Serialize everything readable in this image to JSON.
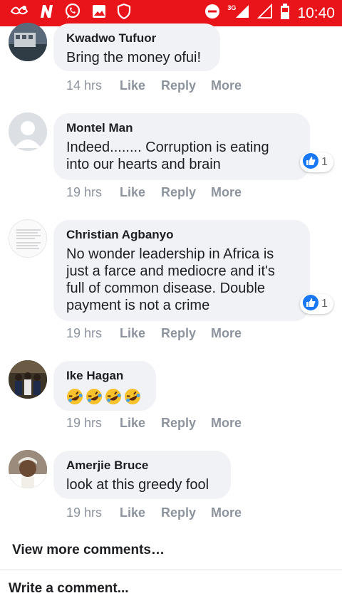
{
  "status_bar": {
    "time": "10:40",
    "network": "3G",
    "icons": [
      "notification-app-icon",
      "n-app-icon",
      "whatsapp-icon",
      "image-icon",
      "shield-icon",
      "do-not-disturb-icon",
      "signal-icon",
      "signal-empty-icon",
      "battery-icon"
    ],
    "bg_color": "#e8141a"
  },
  "comments": [
    {
      "author": "Kwadwo Tufuor",
      "text": "Bring the money ofui!",
      "time": "14 hrs",
      "like": "Like",
      "reply": "Reply",
      "more": "More",
      "reactions": null
    },
    {
      "author": "Montel Man",
      "text": "Indeed........ Corruption is eating\ninto our hearts and brain",
      "time": "19 hrs",
      "like": "Like",
      "reply": "Reply",
      "more": "More",
      "reactions": "1"
    },
    {
      "author": "Christian Agbanyo",
      "text": "No wonder leadership in Africa is\njust a farce and mediocre and it's\nfull of common disease. Double\npayment is not a crime",
      "time": "19 hrs",
      "like": "Like",
      "reply": "Reply",
      "more": "More",
      "reactions": "1"
    },
    {
      "author": "Ike Hagan",
      "text": "",
      "emoji": "rolling-on-floor-laughing x4",
      "time": "19 hrs",
      "like": "Like",
      "reply": "Reply",
      "more": "More",
      "reactions": null
    },
    {
      "author": "Amerjie Bruce",
      "text": "look at this greedy fool",
      "time": "19 hrs",
      "like": "Like",
      "reply": "Reply",
      "more": "More",
      "reactions": null
    }
  ],
  "view_more": "View more comments…",
  "write_comment": "Write a comment...",
  "colors": {
    "bubble": "#f0f2f5",
    "meta": "#8d949e",
    "like_blue": "#1877f2"
  }
}
